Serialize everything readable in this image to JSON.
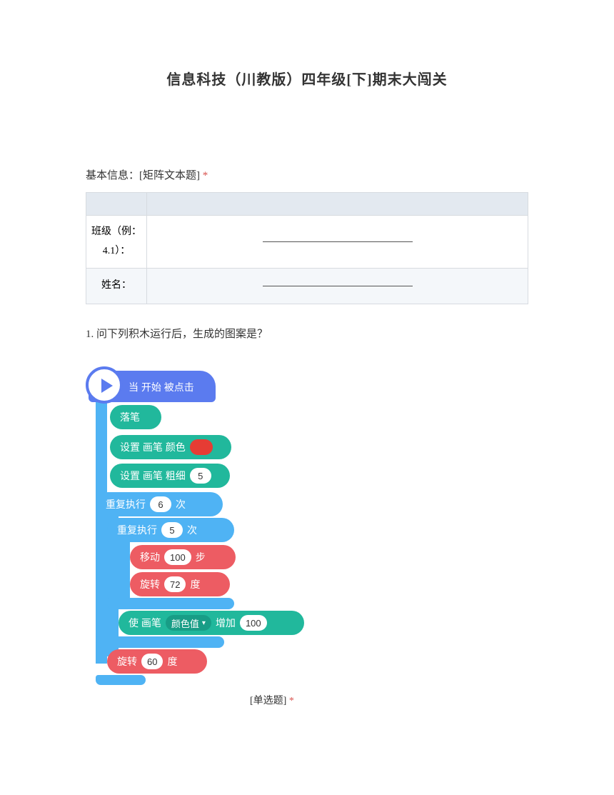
{
  "title": "信息科技（川教版）四年级[下]期末大闯关",
  "basic_info": {
    "label": "基本信息：[矩阵文本题]",
    "required_mark": "*",
    "rows": [
      {
        "label": "班级（例：4.1）："
      },
      {
        "label": "姓名："
      }
    ]
  },
  "q1": {
    "number": "1.",
    "text": "问下列积木运行后，生成的图案是？",
    "type_label": "[单选题]",
    "required_mark": "*"
  },
  "blocks": {
    "hat": "当 开始 被点击",
    "pen_down": "落笔",
    "set_color_prefix": "设置 画笔 颜色",
    "set_size_prefix": "设置 画笔 粗细",
    "set_size_value": "5",
    "repeat_outer_prefix": "重复执行",
    "repeat_outer_value": "6",
    "repeat_outer_suffix": "次",
    "repeat_inner_prefix": "重复执行",
    "repeat_inner_value": "5",
    "repeat_inner_suffix": "次",
    "move_prefix": "移动",
    "move_value": "100",
    "move_suffix": "步",
    "rotate1_prefix": "旋转",
    "rotate1_value": "72",
    "rotate1_suffix": "度",
    "change_color_prefix": "使 画笔",
    "change_color_dropdown": "颜色值",
    "change_color_mid": "增加",
    "change_color_value": "100",
    "rotate2_prefix": "旋转",
    "rotate2_value": "60",
    "rotate2_suffix": "度"
  }
}
